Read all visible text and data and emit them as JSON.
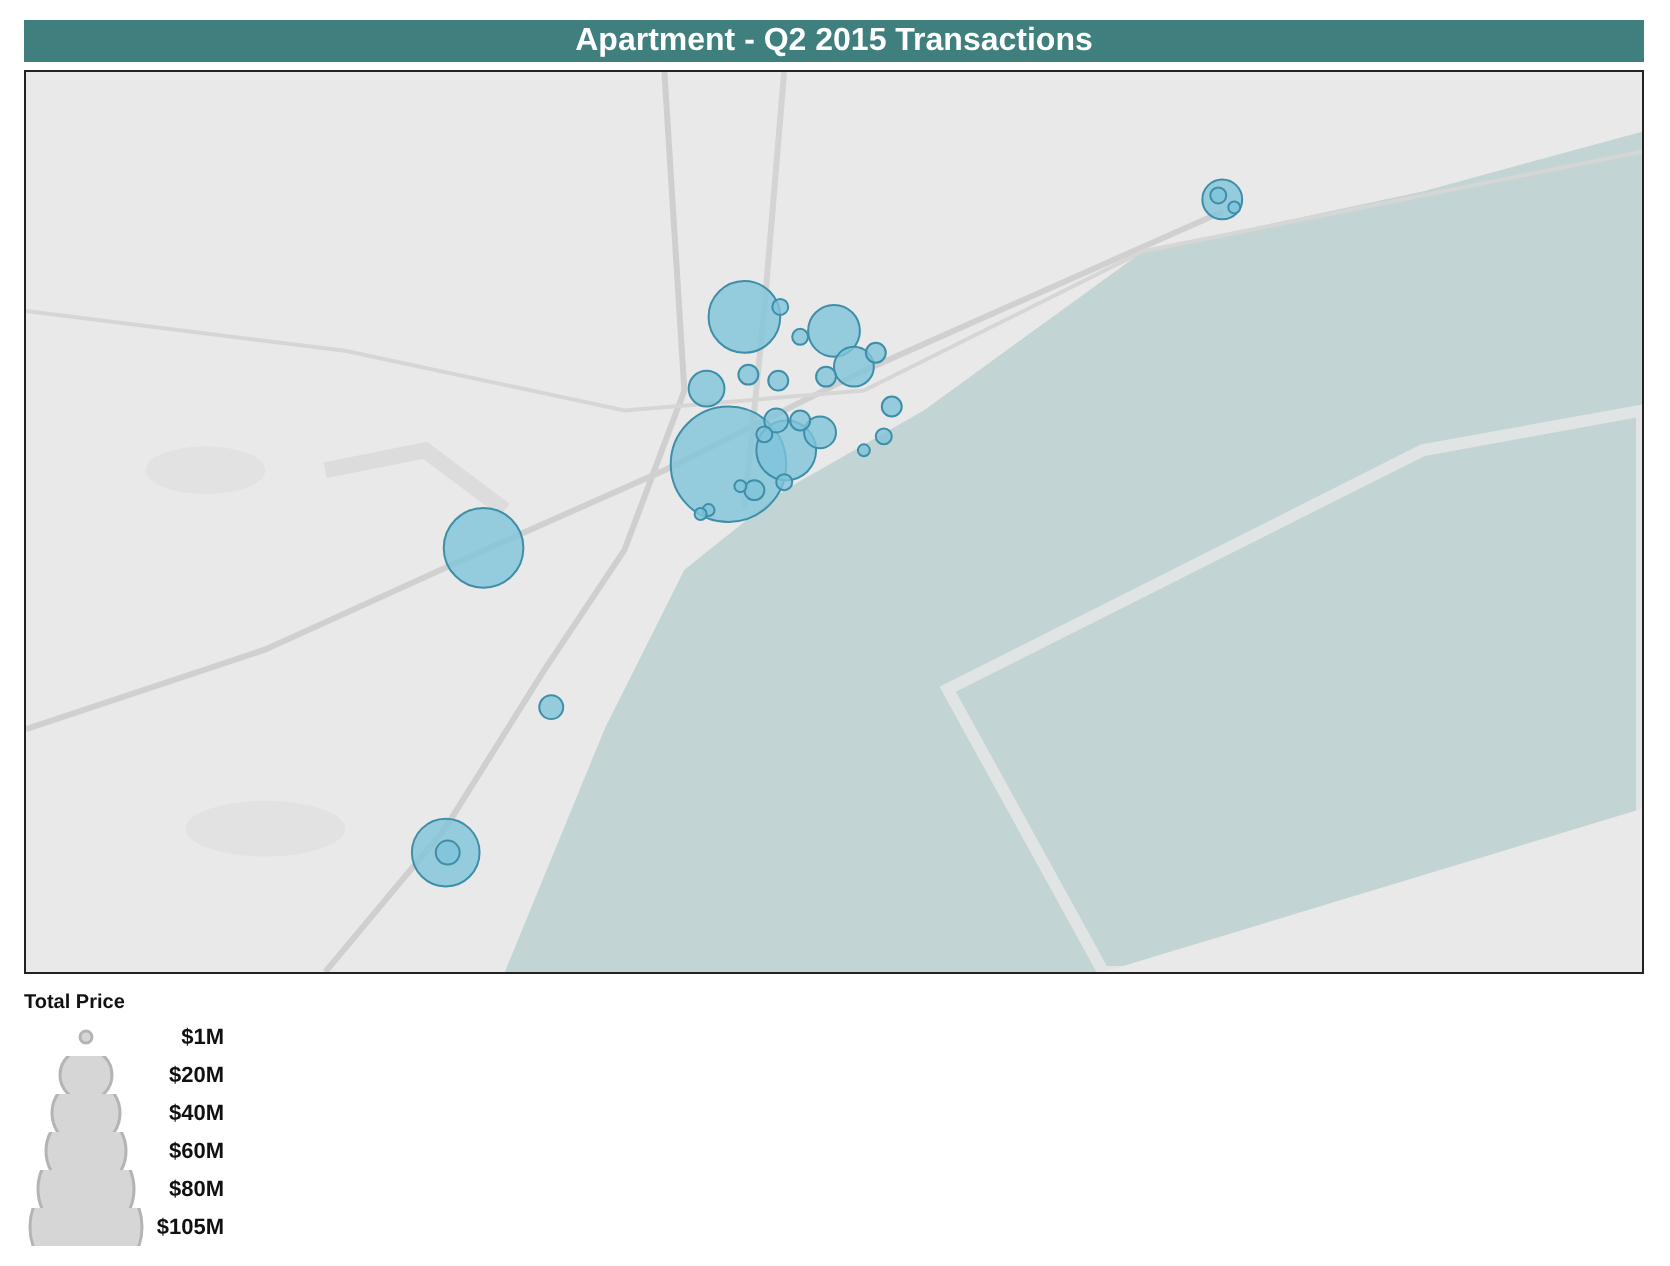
{
  "title": "Apartment - Q2 2015 Transactions",
  "legend": {
    "title": "Total Price",
    "items": [
      {
        "label": "$1M"
      },
      {
        "label": "$20M"
      },
      {
        "label": "$40M"
      },
      {
        "label": "$60M"
      },
      {
        "label": "$80M"
      },
      {
        "label": "$105M"
      }
    ]
  }
}
